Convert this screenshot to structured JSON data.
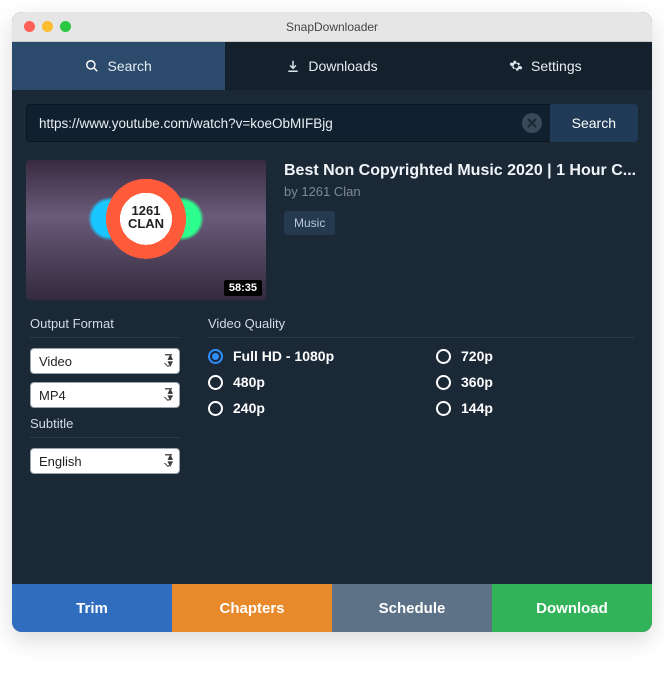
{
  "window": {
    "title": "SnapDownloader"
  },
  "tabs": {
    "search": "Search",
    "downloads": "Downloads",
    "settings": "Settings"
  },
  "search": {
    "url_value": "https://www.youtube.com/watch?v=koeObMIFBjg",
    "button": "Search"
  },
  "video": {
    "title": "Best Non Copyrighted Music 2020 | 1 Hour C...",
    "author_prefix": "by ",
    "author": "1261 Clan",
    "duration": "58:35",
    "tag": "Music",
    "logo_line1": "1261",
    "logo_line2": "CLAN"
  },
  "output_format": {
    "label": "Output Format",
    "type_value": "Video",
    "container_value": "MP4"
  },
  "subtitle": {
    "label": "Subtitle",
    "value": "English"
  },
  "quality": {
    "label": "Video Quality",
    "options": [
      {
        "label": "Full HD - 1080p",
        "selected": true
      },
      {
        "label": "720p",
        "selected": false
      },
      {
        "label": "480p",
        "selected": false
      },
      {
        "label": "360p",
        "selected": false
      },
      {
        "label": "240p",
        "selected": false
      },
      {
        "label": "144p",
        "selected": false
      }
    ]
  },
  "actions": {
    "trim": "Trim",
    "chapters": "Chapters",
    "schedule": "Schedule",
    "download": "Download"
  }
}
